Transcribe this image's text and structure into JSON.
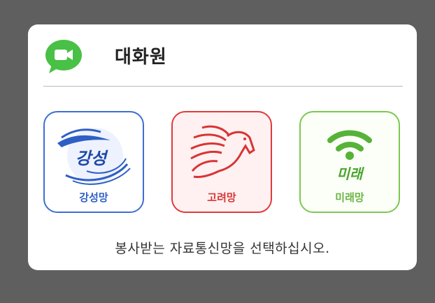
{
  "dialog": {
    "title": "대화원",
    "app_icon": "video-call-icon",
    "instruction": "봉사받는 자료통신망을 선택하십시오."
  },
  "options": [
    {
      "label": "강성망",
      "logo_text": "강성",
      "icon": "wave-logo-icon",
      "color": "#3d6fd1"
    },
    {
      "label": "고려망",
      "icon": "horse-logo-icon",
      "color": "#e13a3a"
    },
    {
      "label": "미래망",
      "logo_text": "미래",
      "icon": "wifi-icon",
      "color": "#7cc84f"
    }
  ]
}
